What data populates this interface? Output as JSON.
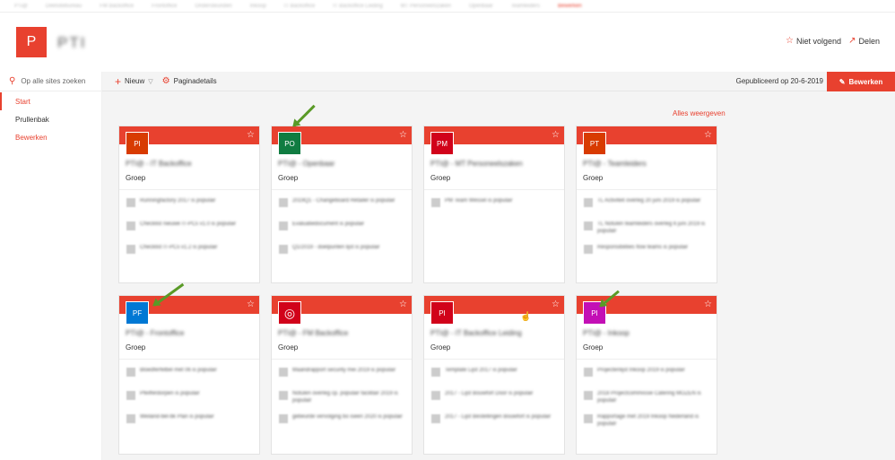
{
  "top_nav": {
    "items": [
      "PTi@",
      "Deelsitebureau",
      "FM Backoffice",
      "Frontoffice",
      "Ondersteunden",
      "Inkoop",
      "IT Backoffice",
      "IT Backoffice Leiding",
      "MT Personeelszaken",
      "Openbaar",
      "Teamleiders",
      "Bewerken"
    ]
  },
  "header": {
    "logo_letter": "P",
    "site_title": "PTI",
    "follow_label": "Niet volgend",
    "share_label": "Delen"
  },
  "left_nav": {
    "search_placeholder": "Op alle sites zoeken",
    "items": [
      {
        "label": "Start"
      },
      {
        "label": "Prullenbak"
      },
      {
        "label": "Bewerken"
      }
    ]
  },
  "command_bar": {
    "new_label": "Nieuw",
    "page_details_label": "Paginadetails",
    "published_text": "Gepubliceerd op 20-6-2019",
    "edit_label": "Bewerken"
  },
  "content": {
    "see_all_label": "Alles weergeven",
    "cards": [
      {
        "initials": "PI",
        "color": "#d83b01",
        "name": "PTI@ - IT Backoffice",
        "group": "Groep",
        "items": [
          "Runningfactory 2017 is populair",
          "Checklist nieuwe IT-PCs v1.0 is populair",
          "Checklist IT-PCs v1.2 is populair"
        ]
      },
      {
        "initials": "PO",
        "color": "#107c41",
        "name": "PTI@ - Openbaar",
        "group": "Groep",
        "items": [
          "2019Q1 - Changeboard Retailer is populair",
          "Evaluatiedocument is populair",
          "Q1/2019 - doelpunten lijst is populair"
        ]
      },
      {
        "initials": "PM",
        "color": "#d1021a",
        "name": "PTI@ - MT Personeelszaken",
        "group": "Groep",
        "items": [
          "PM Team Wessel is populair"
        ]
      },
      {
        "initials": "PT",
        "color": "#d83b01",
        "name": "PTI@ - Teamleiders",
        "group": "Groep",
        "items": [
          "TL Activiteit overleg 20 juni 2019 is populair",
          "TL Notulen teamleiders overleg 6 juni 2019 is populair",
          "Responsibilities flow teams is populair"
        ]
      },
      {
        "initials": "PF",
        "color": "#0078d4",
        "name": "PTI@ - Frontoffice",
        "group": "Groep",
        "items": [
          "Bloedferfelbel met 06 is populair",
          "Pfeifferdorpen is populair",
          "Weiland-bel-bk Plan is populair"
        ]
      },
      {
        "initials": "globe",
        "color": "#d1021a",
        "name": "PTI@ - FM Backoffice",
        "group": "Groep",
        "items": [
          "Maandrapport security mei 2019 is populair",
          "Notulen overleg cp. populair facilitair 2019 is populair",
          "gebeurde vervolging bo iseen 2020 is populair"
        ]
      },
      {
        "initials": "PI",
        "color": "#d1021a",
        "name": "PTI@ - IT Backoffice Leiding",
        "group": "Groep",
        "items": [
          "Template Lijst 2017 is populair",
          "2017 - Lijst Bouwfort Door is populair",
          "2017 - Lijst Bestellingen Bouwfort is populair"
        ]
      },
      {
        "initials": "PI",
        "color": "#c30fb5",
        "name": "PTI@ - Inkoop",
        "group": "Groep",
        "items": [
          "Projectenlijst Inkoop 2019 is populair",
          "2018 Projectcommissie Catering MOZEN is populair",
          "Rapportage met 2019 Inkoop Nederland is populair"
        ]
      }
    ]
  }
}
